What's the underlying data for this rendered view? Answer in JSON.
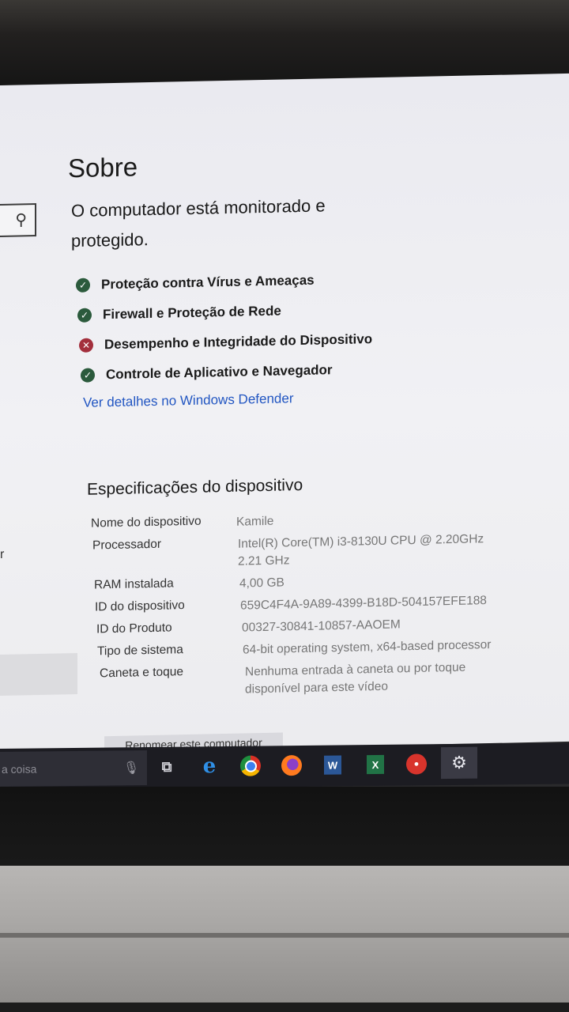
{
  "page": {
    "title": "Sobre",
    "protection_status": "O computador está monitorado e protegido.",
    "protection_items": [
      {
        "label": "Proteção contra Vírus e Ameaças",
        "status": "ok"
      },
      {
        "label": "Firewall e Proteção de Rede",
        "status": "ok"
      },
      {
        "label": "Desempenho e Integridade do Dispositivo",
        "status": "error"
      },
      {
        "label": "Controle de Aplicativo e Navegador",
        "status": "ok"
      }
    ],
    "defender_link": "Ver detalhes no Windows Defender"
  },
  "specs": {
    "title": "Especificações do dispositivo",
    "rows": [
      {
        "label": "Nome do dispositivo",
        "value": "Kamile"
      },
      {
        "label": "Processador",
        "value": "Intel(R) Core(TM) i3-8130U CPU @ 2.20GHz 2.21 GHz"
      },
      {
        "label": "RAM instalada",
        "value": "4,00 GB"
      },
      {
        "label": "ID do dispositivo",
        "value": "659C4F4A-9A89-4399-B18D-504157EFE188"
      },
      {
        "label": "ID do Produto",
        "value": "00327-30841-10857-AAOEM"
      },
      {
        "label": "Tipo de sistema",
        "value": "64-bit operating system, x64-based processor"
      },
      {
        "label": "Caneta e toque",
        "value": "Nenhuma entrada à caneta ou por toque disponível para este vídeo"
      }
    ],
    "rename_button": "Renomear este computador"
  },
  "sidebar": {
    "partial_letter": "r"
  },
  "taskbar": {
    "search_placeholder": "a coisa",
    "icons": [
      "microphone-icon",
      "task-view-icon",
      "edge-icon",
      "chrome-icon",
      "firefox-icon",
      "word-icon",
      "excel-icon",
      "app-icon",
      "settings-icon"
    ]
  },
  "colors": {
    "link": "#2256c2",
    "ok": "#2b5a3c",
    "error": "#a32f3c",
    "taskbar": "#1c1c22"
  }
}
